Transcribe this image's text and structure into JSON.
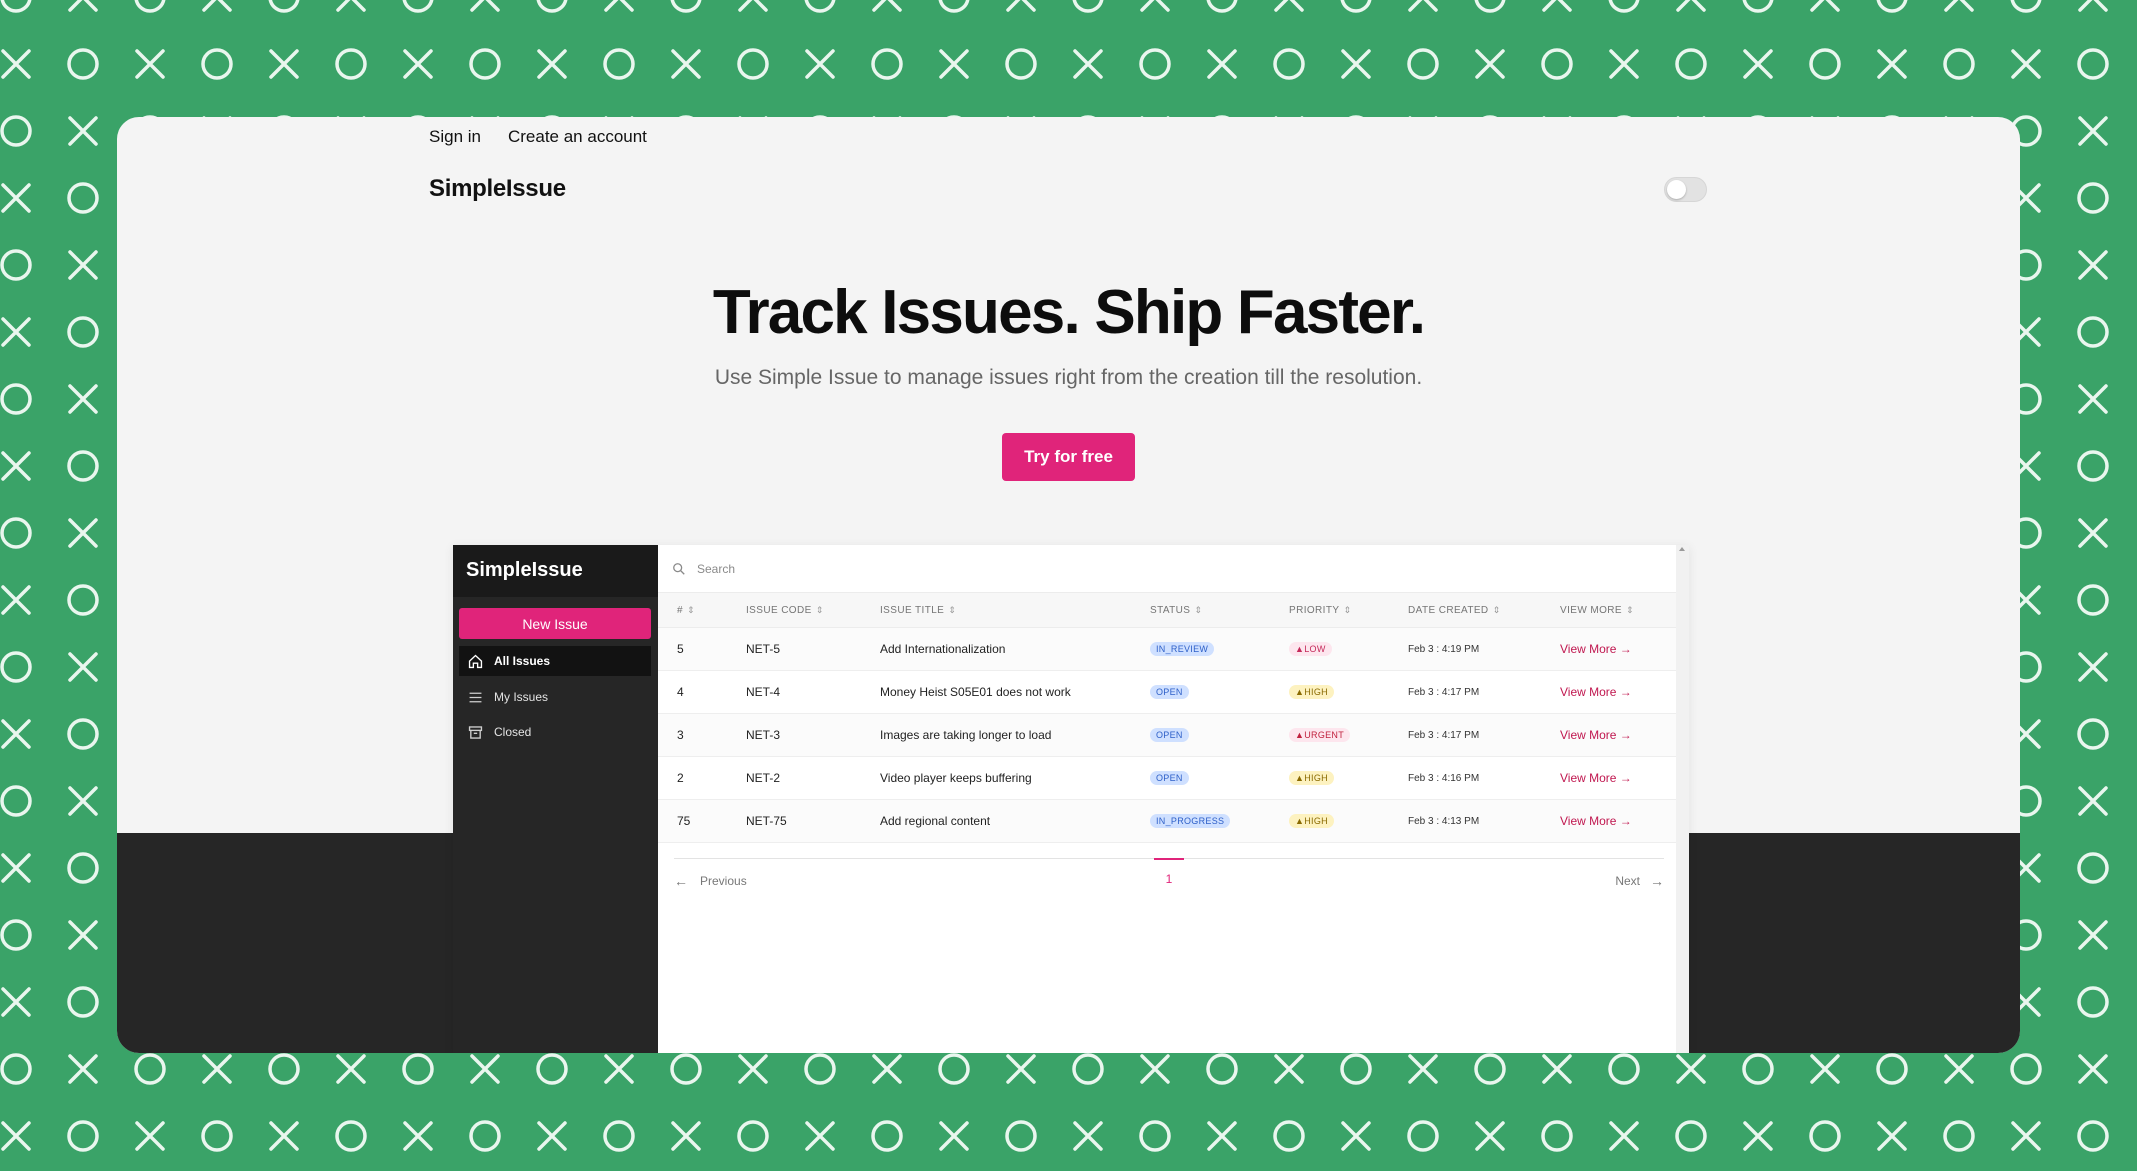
{
  "colors": {
    "background_green": "#3aa368",
    "accent_pink": "#e0247a",
    "pattern_stroke": "#e9f6ee"
  },
  "nav": {
    "sign_in": "Sign in",
    "create_account": "Create an account",
    "brand": "SimpleIssue",
    "theme_toggle_icon": "toggle-switch"
  },
  "hero": {
    "title": "Track Issues. Ship Faster.",
    "subtitle": "Use Simple Issue to manage issues right from the creation till the resolution.",
    "cta": "Try for free"
  },
  "app": {
    "brand": "SimpleIssue",
    "new_issue": "New Issue",
    "sidebar": [
      {
        "label": "All Issues",
        "icon": "home-icon",
        "active": true
      },
      {
        "label": "My Issues",
        "icon": "list-icon",
        "active": false
      },
      {
        "label": "Closed",
        "icon": "archive-icon",
        "active": false
      }
    ],
    "search_placeholder": "Search",
    "columns": [
      "#",
      "ISSUE CODE",
      "ISSUE TITLE",
      "STATUS",
      "PRIORITY",
      "DATE CREATED",
      "VIEW MORE"
    ],
    "rows": [
      {
        "num": "5",
        "code": "NET-5",
        "title": "Add Internationalization",
        "status": "IN_REVIEW",
        "priority": "LOW",
        "date": "Feb 3 : 4:19 PM",
        "view": "View More →"
      },
      {
        "num": "4",
        "code": "NET-4",
        "title": "Money Heist S05E01 does not work",
        "status": "OPEN",
        "priority": "HIGH",
        "date": "Feb 3 : 4:17 PM",
        "view": "View More →"
      },
      {
        "num": "3",
        "code": "NET-3",
        "title": "Images are taking longer to load",
        "status": "OPEN",
        "priority": "URGENT",
        "date": "Feb 3 : 4:17 PM",
        "view": "View More →"
      },
      {
        "num": "2",
        "code": "NET-2",
        "title": "Video player keeps buffering",
        "status": "OPEN",
        "priority": "HIGH",
        "date": "Feb 3 : 4:16 PM",
        "view": "View More →"
      },
      {
        "num": "75",
        "code": "NET-75",
        "title": "Add regional content",
        "status": "IN_PROGRESS",
        "priority": "HIGH",
        "date": "Feb 3 : 4:13 PM",
        "view": "View More →"
      }
    ],
    "pagination": {
      "previous": "Previous",
      "page": "1",
      "next": "Next"
    }
  }
}
